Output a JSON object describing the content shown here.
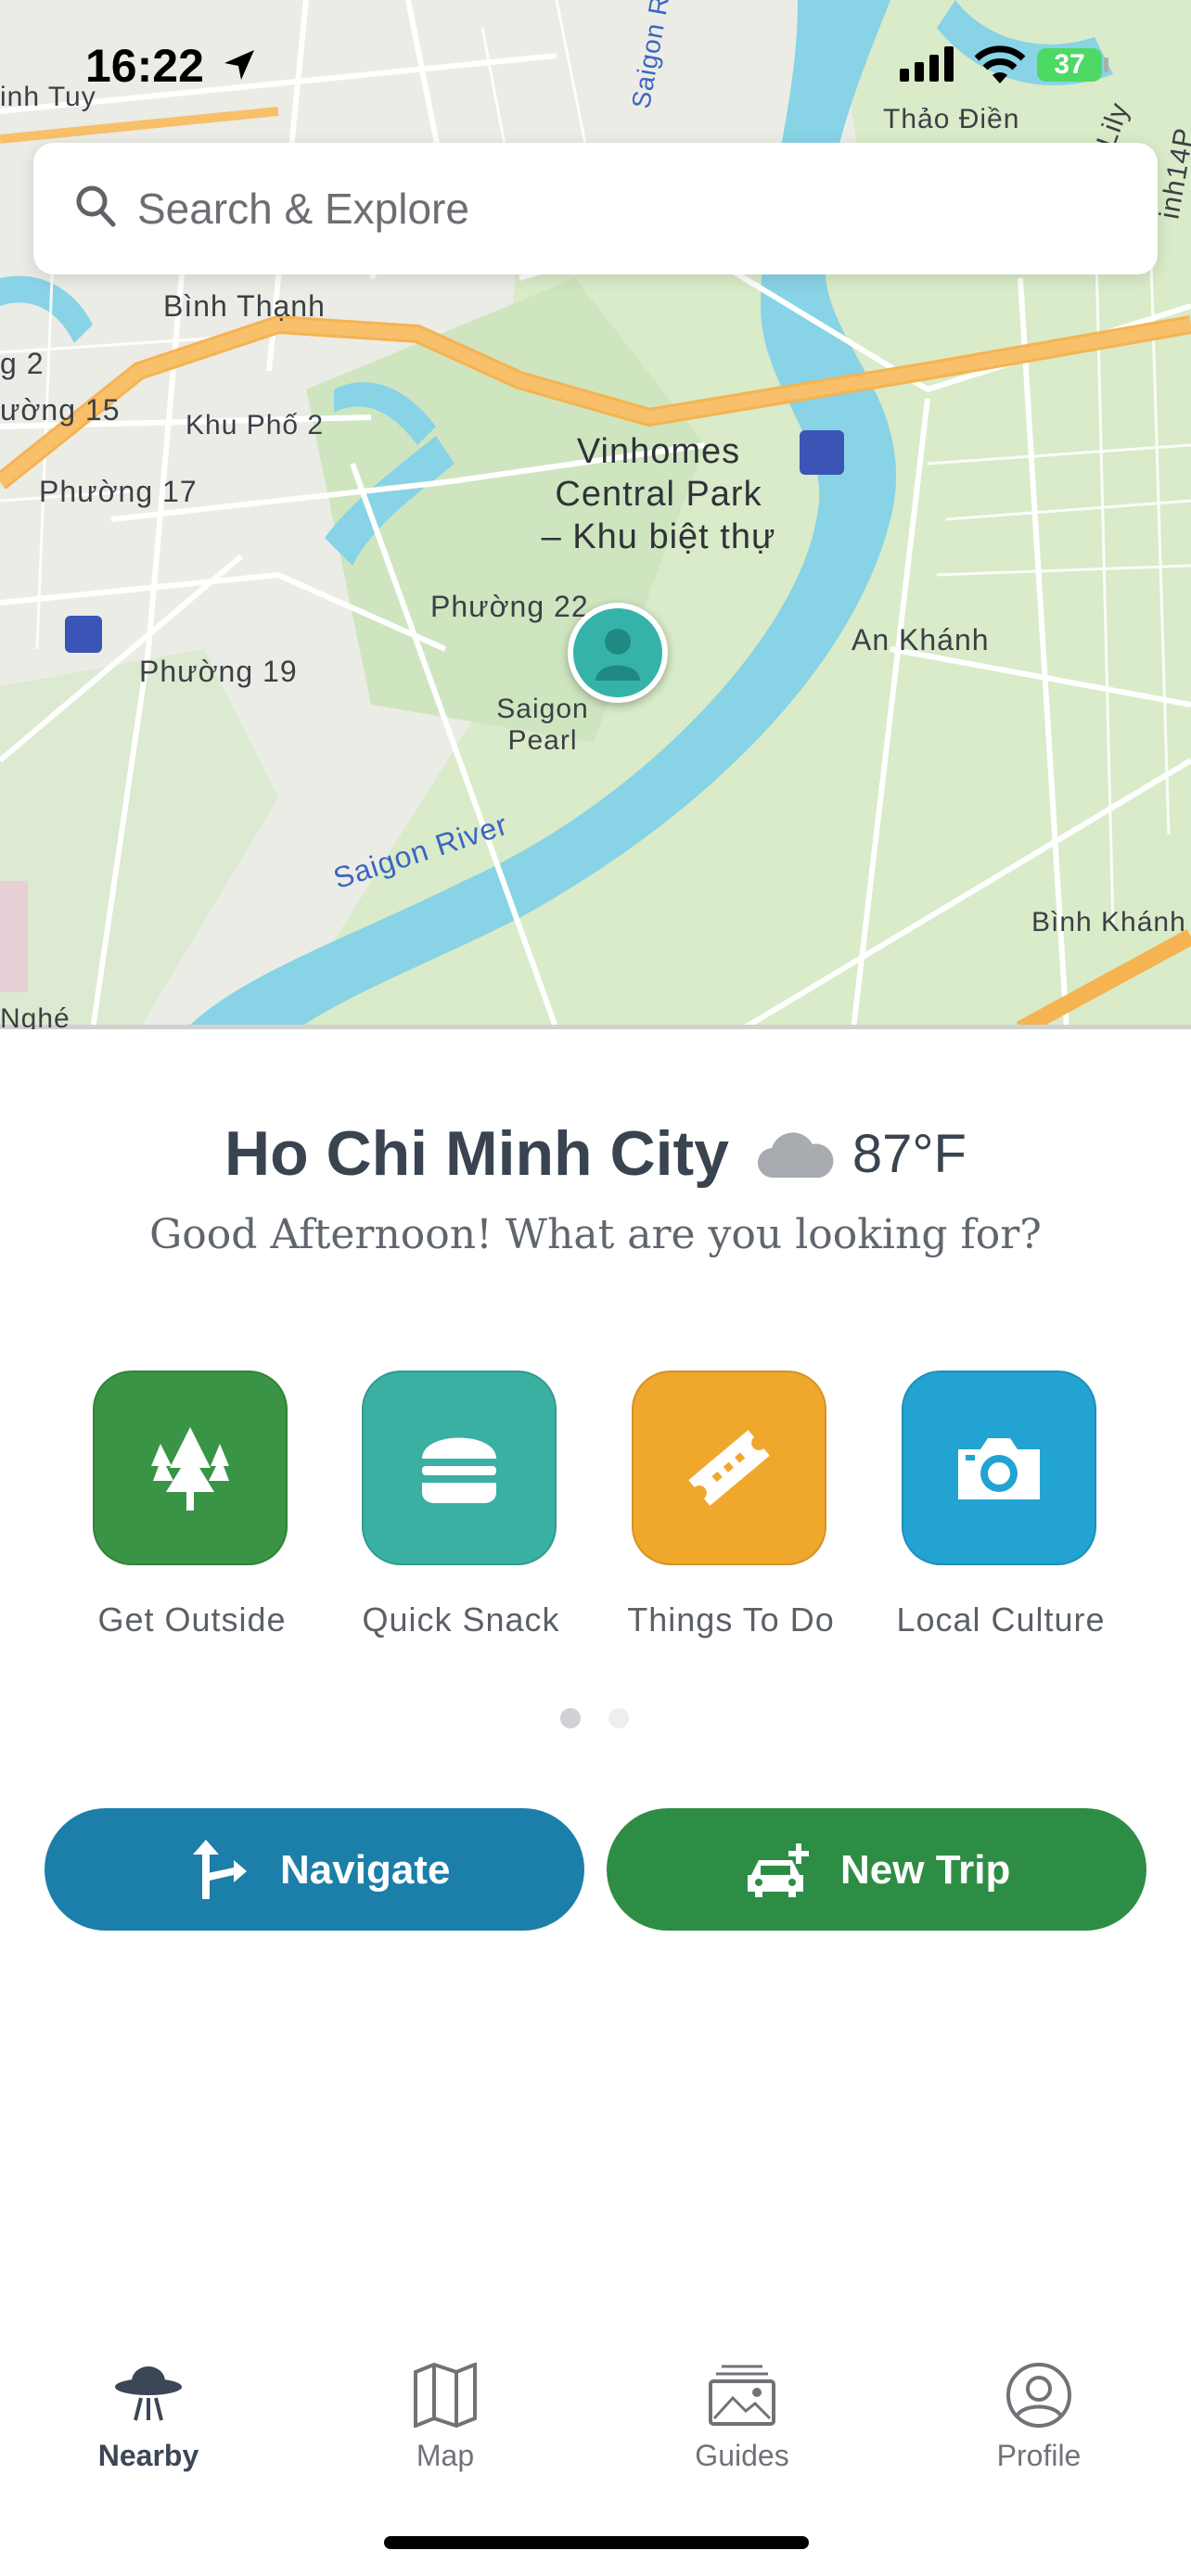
{
  "status_bar": {
    "time": "16:22",
    "battery": "37"
  },
  "search": {
    "placeholder": "Search & Explore"
  },
  "map": {
    "labels": {
      "inh_tuy": "inh Tuy",
      "thao_dien": "Thảo Điền",
      "binh_thanh": "Bình Thạnh",
      "phuong_15": "ường 15",
      "p_2": "g 2",
      "khu_pho_2": "Khu Phố 2",
      "phuong_17": "Phường 17",
      "vinhomes": "Vinhomes",
      "central_park": "Central Park",
      "khu_biet_thu": "– Khu biệt thự",
      "phuong_22": "Phường 22",
      "phuong_19": "Phường 19",
      "saigon_pearl_1": "Saigon",
      "saigon_pearl_2": "Pearl",
      "an_khanh": "An Khánh",
      "saigon_river": "Saigon River",
      "saigon_river_top": "Saigon R",
      "binh_khanh": "Bình Khánh",
      "nghe": "Nghé",
      "lily": "Lily",
      "inh14p": "inh14P"
    }
  },
  "location": {
    "city": "Ho Chi Minh City",
    "temperature": "87°F",
    "weather_icon": "cloud-icon"
  },
  "greeting": "Good Afternoon! What are you looking for?",
  "categories": [
    {
      "label": "Get Outside",
      "color": "#3a9445",
      "icon": "trees-icon"
    },
    {
      "label": "Quick Snack",
      "color": "#3ab0a3",
      "icon": "burger-icon"
    },
    {
      "label": "Things To Do",
      "color": "#f0a82c",
      "icon": "ticket-icon"
    },
    {
      "label": "Local Culture",
      "color": "#22a3d2",
      "icon": "camera-icon"
    }
  ],
  "pager": {
    "pages": 2,
    "current": 1
  },
  "actions": {
    "navigate": {
      "label": "Navigate",
      "color": "#1b7fa9"
    },
    "new_trip": {
      "label": "New Trip",
      "color": "#2e8d45"
    }
  },
  "tabs": [
    {
      "label": "Nearby",
      "icon": "ufo-icon",
      "active": true
    },
    {
      "label": "Map",
      "icon": "map-icon",
      "active": false
    },
    {
      "label": "Guides",
      "icon": "guides-icon",
      "active": false
    },
    {
      "label": "Profile",
      "icon": "profile-icon",
      "active": false
    }
  ]
}
